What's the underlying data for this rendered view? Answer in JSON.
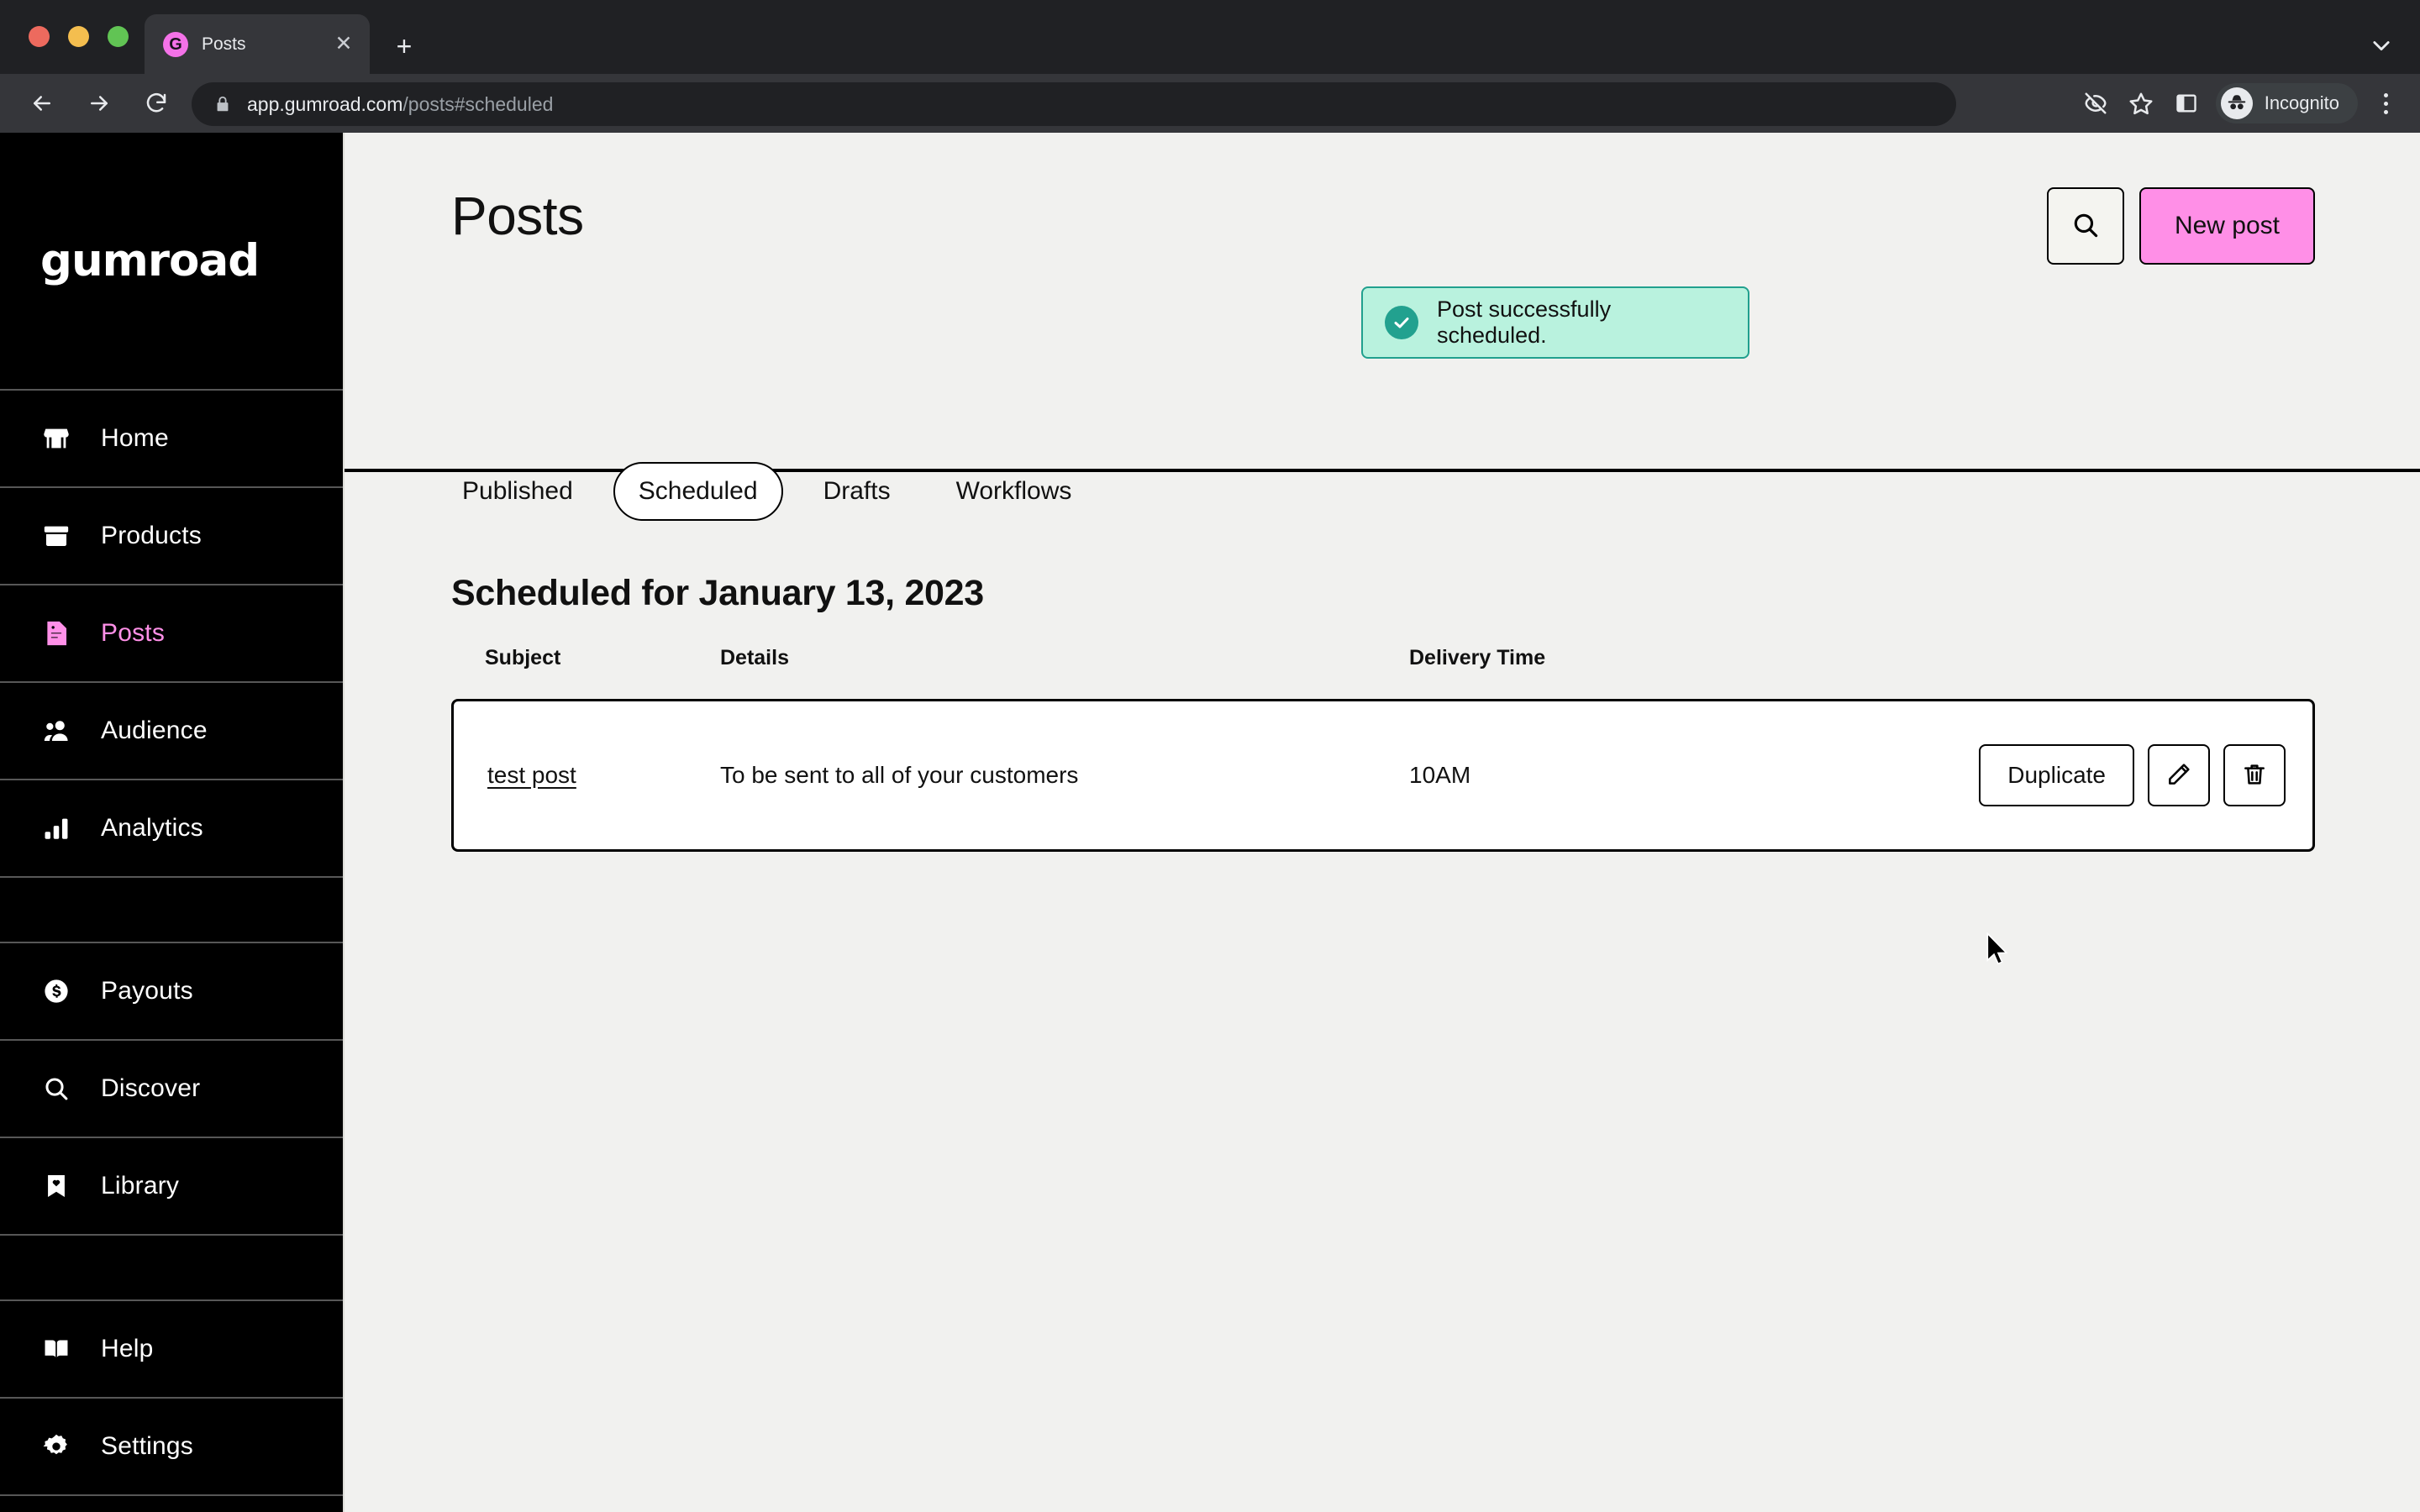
{
  "browser": {
    "tab": {
      "title": "Posts",
      "favicon_letter": "G",
      "favicon_color": "#F472E8",
      "close_icon": "close-icon"
    },
    "new_tab_icon": "plus-icon",
    "tabstrip_chevron_icon": "chevron-down-icon",
    "nav": {
      "back_icon": "back-arrow-icon",
      "forward_icon": "forward-arrow-icon",
      "reload_icon": "reload-icon"
    },
    "omnibox": {
      "lock_icon": "lock-icon",
      "host": "app.gumroad.com",
      "path": "/posts#scheduled"
    },
    "toolbar_right": {
      "tracking_protection_icon": "eye-off-icon",
      "bookmark_icon": "star-icon",
      "side_panel_icon": "side-panel-icon",
      "profile_label": "Incognito",
      "profile_icon": "incognito-icon",
      "menu_icon": "kebab-menu-icon"
    }
  },
  "sidebar": {
    "brand": "gumroad",
    "items": [
      {
        "label": "Home",
        "icon": "storefront-icon",
        "active": false
      },
      {
        "label": "Products",
        "icon": "box-icon",
        "active": false
      },
      {
        "label": "Posts",
        "icon": "document-icon",
        "active": true
      },
      {
        "label": "Audience",
        "icon": "people-icon",
        "active": false
      },
      {
        "label": "Analytics",
        "icon": "bar-chart-icon",
        "active": false
      },
      {
        "label": "Payouts",
        "icon": "dollar-coin-icon",
        "active": false
      },
      {
        "label": "Discover",
        "icon": "search-icon",
        "active": false
      },
      {
        "label": "Library",
        "icon": "bookmark-heart-icon",
        "active": false
      },
      {
        "label": "Help",
        "icon": "book-icon",
        "active": false
      },
      {
        "label": "Settings",
        "icon": "gear-icon",
        "active": false
      }
    ]
  },
  "header": {
    "title": "Posts",
    "search_icon": "search-icon",
    "new_post_label": "New post",
    "new_post_color": "#FF8FE7"
  },
  "toast": {
    "message": "Post successfully scheduled.",
    "icon": "check-circle-icon",
    "bg_color": "#B9F2DE",
    "border_color": "#21A08E",
    "icon_color": "#22A18F"
  },
  "tabs": [
    {
      "label": "Published",
      "selected": false
    },
    {
      "label": "Scheduled",
      "selected": true
    },
    {
      "label": "Drafts",
      "selected": false
    },
    {
      "label": "Workflows",
      "selected": false
    }
  ],
  "content": {
    "section_title": "Scheduled for January 13, 2023",
    "columns": [
      "Subject",
      "Details",
      "Delivery Time",
      ""
    ],
    "rows": [
      {
        "subject": "test post",
        "details": "To be sent to all of your customers",
        "delivery_time": "10AM",
        "duplicate_label": "Duplicate",
        "edit_icon": "pencil-icon",
        "delete_icon": "trash-icon"
      }
    ]
  }
}
